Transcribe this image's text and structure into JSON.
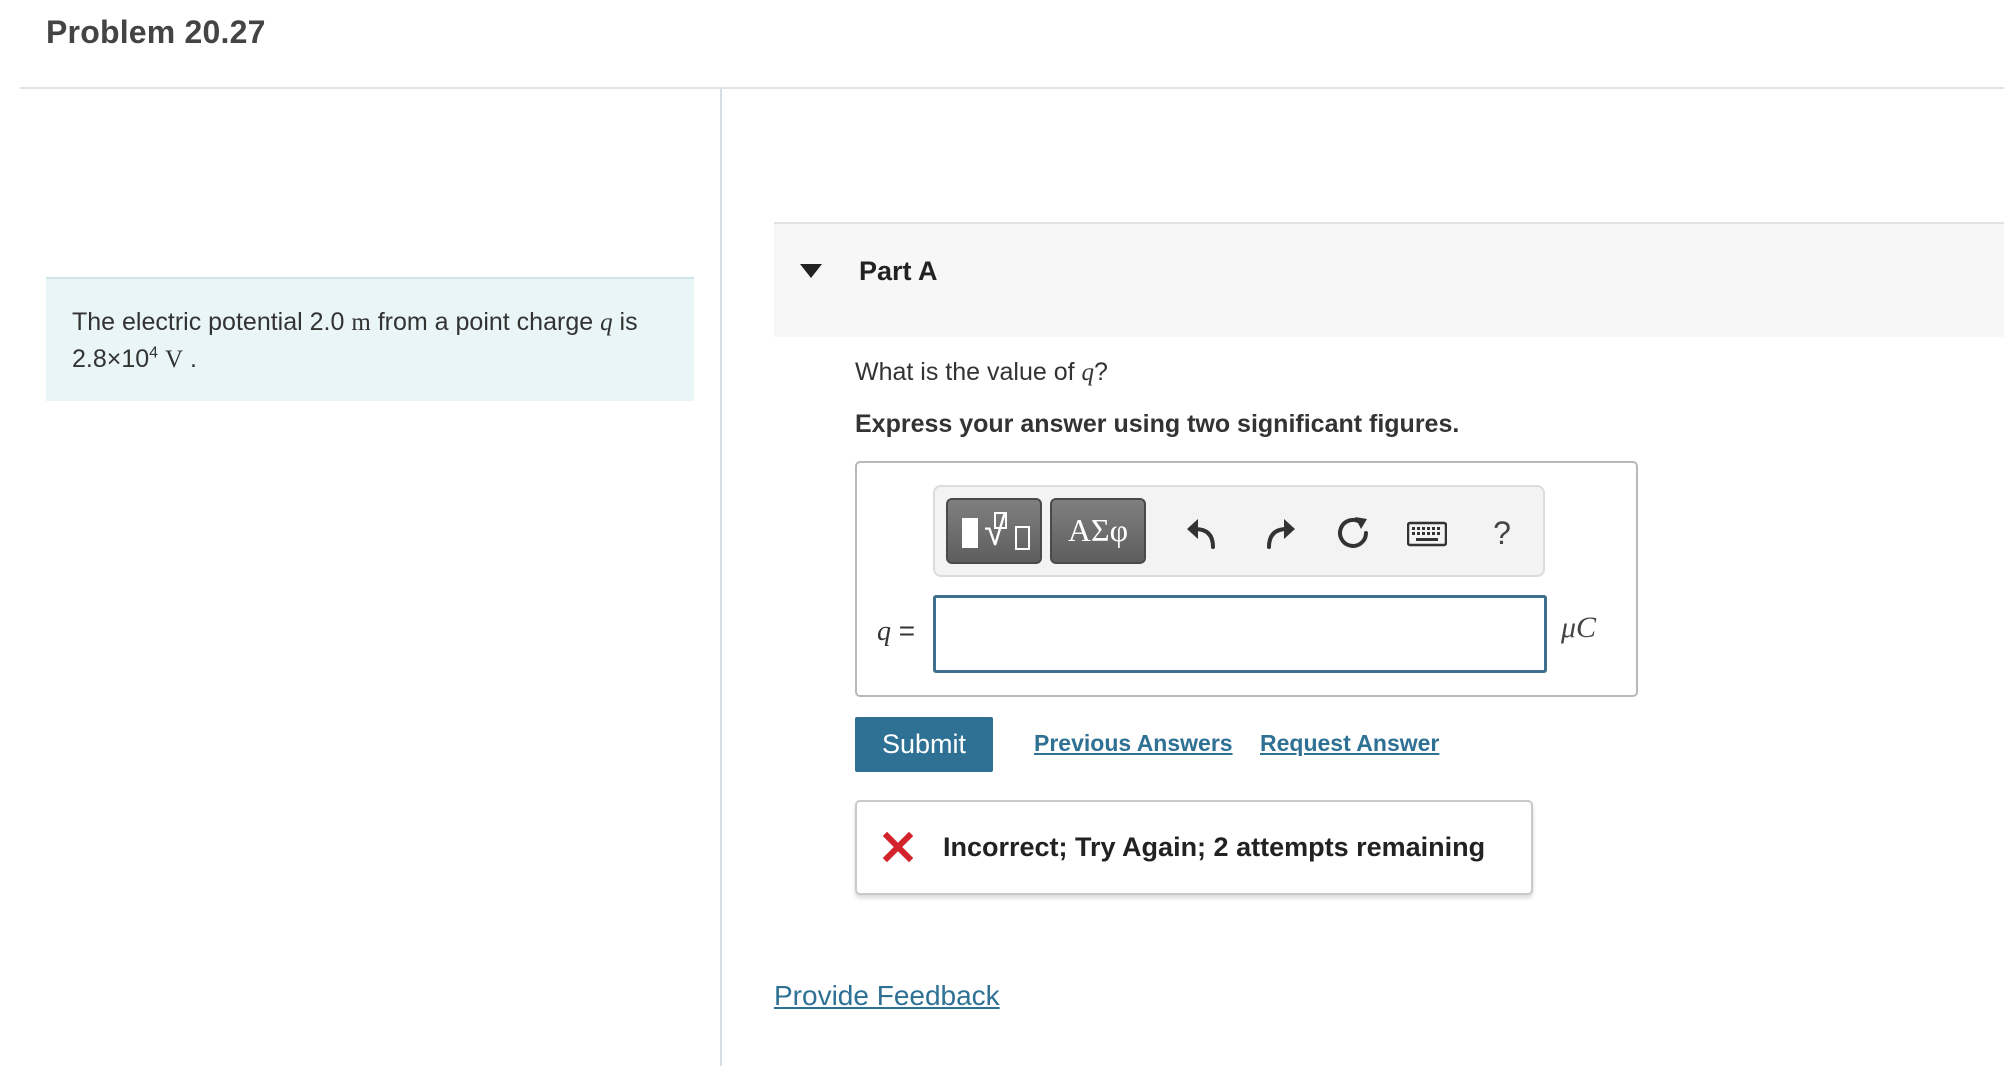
{
  "header": {
    "title": "Problem 20.27"
  },
  "intro": {
    "text_1": "The electric potential 2.0 ",
    "unit_m": "m",
    "text_2": " from a point charge ",
    "var_q": "q",
    "text_3": " is 2.8×10",
    "exponent": "4",
    "unit_v": "V",
    "text_end": " ."
  },
  "part": {
    "title": "Part A",
    "question_1": "What is the value of ",
    "question_var": "q",
    "question_end": "?",
    "instruction": "Express your answer using two significant figures."
  },
  "toolbar": {
    "symbols_label": "ΑΣφ",
    "help_label": "?"
  },
  "answer": {
    "var_label": "q",
    "equals": " =",
    "value": "",
    "unit": "μC"
  },
  "actions": {
    "submit_label": "Submit",
    "previous_answers_label": "Previous Answers",
    "request_answer_label": "Request Answer"
  },
  "feedback": {
    "message": "Incorrect; Try Again; 2 attempts remaining"
  },
  "footer": {
    "provide_feedback_label": "Provide Feedback"
  },
  "colors": {
    "accent": "#2f7194",
    "intro_background": "#e9f5f7",
    "incorrect": "#d2232a"
  }
}
